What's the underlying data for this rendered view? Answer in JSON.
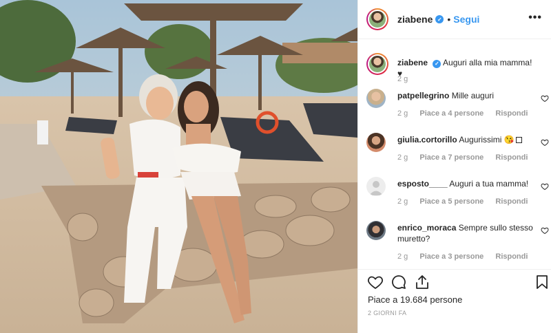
{
  "post": {
    "username": "ziabene",
    "follow_label": "Segui",
    "dot": "•",
    "more": "•••",
    "caption_user": "ziabene",
    "caption_text": "Auguri alla mia mamma! ♥",
    "caption_time": "2 g",
    "likes_label": "Piace a 19.684 persone",
    "timestamp": "2 GIORNI FA"
  },
  "comments": [
    {
      "user": "patpellegrino",
      "text": "Mille auguri",
      "time": "2 g",
      "likes": "Piace a 4 persone",
      "reply": "Rispondi"
    },
    {
      "user": "giulia.cortorillo",
      "text": "Augurissimi 😘",
      "time": "2 g",
      "likes": "Piace a 7 persone",
      "reply": "Rispondi"
    },
    {
      "user": "esposto____",
      "text": "Auguri a tua mamma!",
      "time": "2 g",
      "likes": "Piace a 5 persone",
      "reply": "Rispondi"
    },
    {
      "user": "enrico_moraca",
      "text": "Sempre sullo stesso muretto?",
      "time": "2 g",
      "likes": "Piace a 3 persone",
      "reply": "Rispondi"
    }
  ],
  "icons": {
    "heart": "heart-icon",
    "comment": "comment-icon",
    "share": "share-icon",
    "save": "bookmark-icon",
    "verified": "verified-badge-icon",
    "more": "more-options-icon"
  },
  "colors": {
    "accent": "#3897f0",
    "muted": "#999999",
    "text": "#262626",
    "border": "#efefef"
  }
}
